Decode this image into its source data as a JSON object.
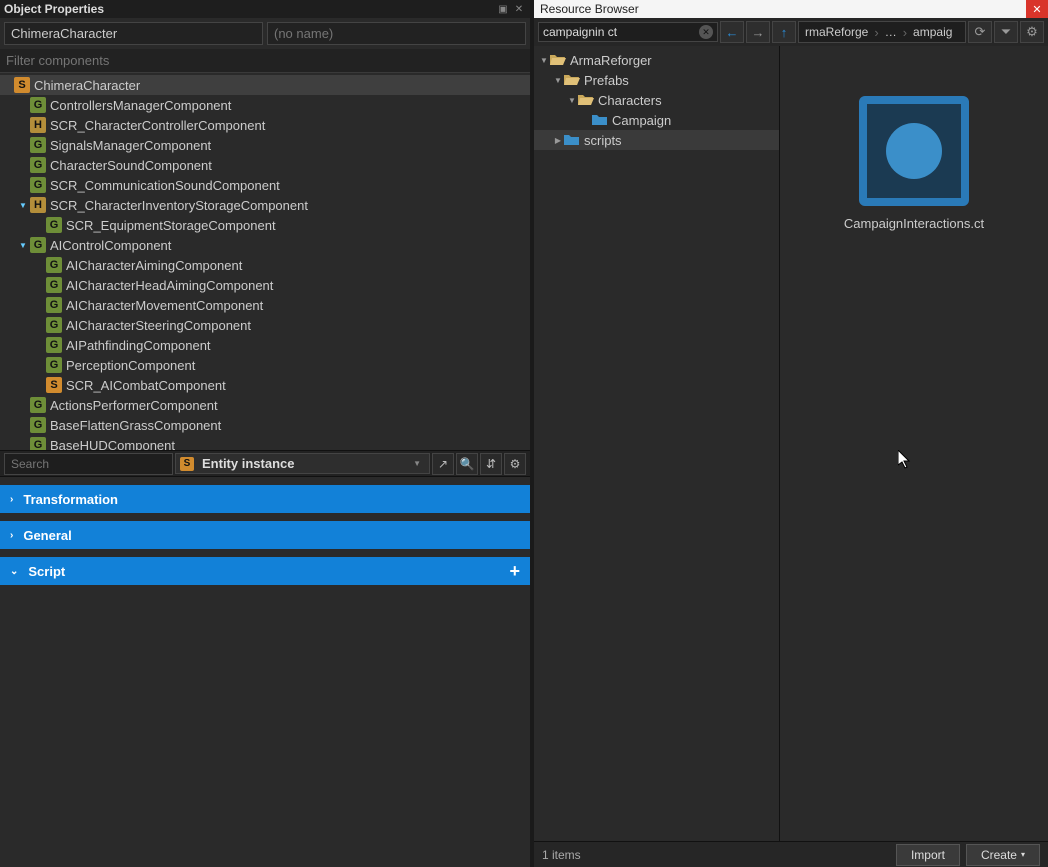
{
  "objectProperties": {
    "title": "Object Properties",
    "entityName": "ChimeraCharacter",
    "entityNamePlaceholder": "(no name)",
    "filterPlaceholder": "Filter components",
    "tree": [
      {
        "level": 0,
        "badge": "S",
        "label": "ChimeraCharacter",
        "selected": true,
        "discState": ""
      },
      {
        "level": 1,
        "badge": "G",
        "label": "ControllersManagerComponent"
      },
      {
        "level": 1,
        "badge": "H",
        "label": "SCR_CharacterControllerComponent"
      },
      {
        "level": 1,
        "badge": "G",
        "label": "SignalsManagerComponent"
      },
      {
        "level": 1,
        "badge": "G",
        "label": "CharacterSoundComponent"
      },
      {
        "level": 1,
        "badge": "G",
        "label": "SCR_CommunicationSoundComponent"
      },
      {
        "level": 1,
        "badge": "H",
        "label": "SCR_CharacterInventoryStorageComponent",
        "discState": "open"
      },
      {
        "level": 2,
        "badge": "G",
        "label": "SCR_EquipmentStorageComponent"
      },
      {
        "level": 1,
        "badge": "G",
        "label": "AIControlComponent",
        "discState": "open"
      },
      {
        "level": 2,
        "badge": "G",
        "label": "AICharacterAimingComponent"
      },
      {
        "level": 2,
        "badge": "G",
        "label": "AICharacterHeadAimingComponent"
      },
      {
        "level": 2,
        "badge": "G",
        "label": "AICharacterMovementComponent"
      },
      {
        "level": 2,
        "badge": "G",
        "label": "AICharacterSteeringComponent"
      },
      {
        "level": 2,
        "badge": "G",
        "label": "AIPathfindingComponent"
      },
      {
        "level": 2,
        "badge": "G",
        "label": "PerceptionComponent"
      },
      {
        "level": 2,
        "badge": "S",
        "label": "SCR_AICombatComponent"
      },
      {
        "level": 1,
        "badge": "G",
        "label": "ActionsPerformerComponent"
      },
      {
        "level": 1,
        "badge": "G",
        "label": "BaseFlattenGrassComponent"
      },
      {
        "level": 1,
        "badge": "G",
        "label": "BaseHUDComponent"
      }
    ],
    "searchPlaceholder": "Search",
    "entityChip": "Entity instance",
    "sections": {
      "transformation": "Transformation",
      "general": "General",
      "script": "Script"
    }
  },
  "resourceBrowser": {
    "title": "Resource Browser",
    "searchValue": "campaignin ct",
    "crumbs": [
      "rmaReforge",
      "…",
      "ampaig"
    ],
    "folders": [
      {
        "level": 0,
        "label": "ArmaReforger",
        "discState": "open",
        "open": true
      },
      {
        "level": 1,
        "label": "Prefabs",
        "discState": "open",
        "open": true
      },
      {
        "level": 2,
        "label": "Characters",
        "discState": "open",
        "open": true
      },
      {
        "level": 3,
        "label": "Campaign",
        "discState": "",
        "open": false
      },
      {
        "level": 1,
        "label": "scripts",
        "discState": "closed",
        "open": false,
        "selected": true
      }
    ],
    "fileLabel": "CampaignInteractions.ct",
    "status": "1 items",
    "importLabel": "Import",
    "createLabel": "Create"
  }
}
